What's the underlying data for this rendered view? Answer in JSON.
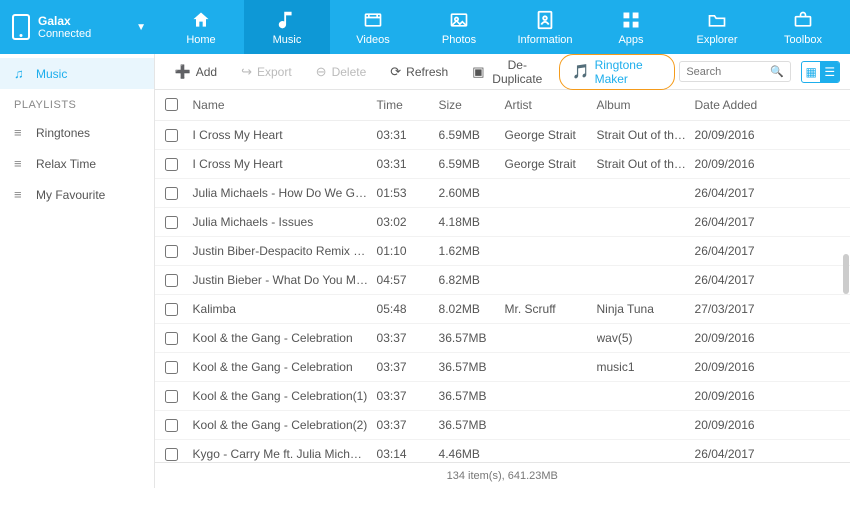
{
  "device": {
    "name": "Galax",
    "status": "Connected"
  },
  "nav": [
    {
      "id": "home",
      "label": "Home"
    },
    {
      "id": "music",
      "label": "Music"
    },
    {
      "id": "videos",
      "label": "Videos"
    },
    {
      "id": "photos",
      "label": "Photos"
    },
    {
      "id": "information",
      "label": "Information"
    },
    {
      "id": "apps",
      "label": "Apps"
    },
    {
      "id": "explorer",
      "label": "Explorer"
    },
    {
      "id": "toolbox",
      "label": "Toolbox"
    }
  ],
  "toolbar": {
    "add": "Add",
    "export": "Export",
    "delete": "Delete",
    "refresh": "Refresh",
    "dedup": "De-Duplicate",
    "ringtone": "Ringtone Maker"
  },
  "search": {
    "placeholder": "Search"
  },
  "sidebar": {
    "music": "Music",
    "playlists_heading": "PLAYLISTS",
    "items": [
      {
        "label": "Ringtones"
      },
      {
        "label": "Relax Time"
      },
      {
        "label": "My Favourite"
      }
    ]
  },
  "columns": {
    "name": "Name",
    "time": "Time",
    "size": "Size",
    "artist": "Artist",
    "album": "Album",
    "date": "Date Added"
  },
  "rows": [
    {
      "name": "I Cross My Heart",
      "time": "03:31",
      "size": "6.59MB",
      "artist": "George Strait",
      "album": "Strait Out of the B...",
      "date": "20/09/2016"
    },
    {
      "name": "I Cross My Heart",
      "time": "03:31",
      "size": "6.59MB",
      "artist": "George Strait",
      "album": "Strait Out of the B...",
      "date": "20/09/2016"
    },
    {
      "name": "Julia Michaels - How Do We Get Ba...",
      "time": "01:53",
      "size": "2.60MB",
      "artist": "",
      "album": "",
      "date": "26/04/2017"
    },
    {
      "name": "Julia Michaels - Issues",
      "time": "03:02",
      "size": "4.18MB",
      "artist": "",
      "album": "",
      "date": "26/04/2017"
    },
    {
      "name": "Justin Biber-Despacito Remix Luis F...",
      "time": "01:10",
      "size": "1.62MB",
      "artist": "",
      "album": "",
      "date": "26/04/2017"
    },
    {
      "name": "Justin Bieber - What Do You Mean",
      "time": "04:57",
      "size": "6.82MB",
      "artist": "",
      "album": "",
      "date": "26/04/2017"
    },
    {
      "name": "Kalimba",
      "time": "05:48",
      "size": "8.02MB",
      "artist": "Mr. Scruff",
      "album": "Ninja Tuna",
      "date": "27/03/2017"
    },
    {
      "name": "Kool & the Gang - Celebration",
      "time": "03:37",
      "size": "36.57MB",
      "artist": "",
      "album": "wav(5)",
      "date": "20/09/2016"
    },
    {
      "name": "Kool & the Gang - Celebration",
      "time": "03:37",
      "size": "36.57MB",
      "artist": "",
      "album": "music1",
      "date": "20/09/2016"
    },
    {
      "name": "Kool & the Gang - Celebration(1)",
      "time": "03:37",
      "size": "36.57MB",
      "artist": "",
      "album": "",
      "date": "20/09/2016"
    },
    {
      "name": "Kool & the Gang - Celebration(2)",
      "time": "03:37",
      "size": "36.57MB",
      "artist": "",
      "album": "",
      "date": "20/09/2016"
    },
    {
      "name": "Kygo - Carry Me ft. Julia Michaels",
      "time": "03:14",
      "size": "4.46MB",
      "artist": "",
      "album": "",
      "date": "26/04/2017"
    }
  ],
  "footer": {
    "status": "134 item(s), 641.23MB"
  }
}
